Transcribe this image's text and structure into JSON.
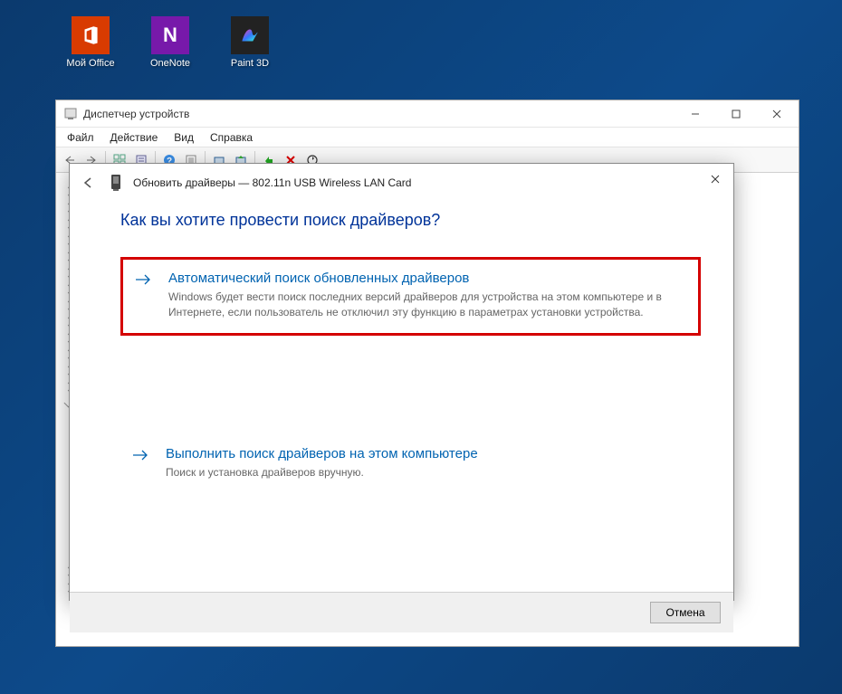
{
  "desktop": {
    "icons": [
      {
        "name": "office",
        "label": "Мой Office"
      },
      {
        "name": "onenote",
        "label": "OneNote",
        "glyph": "N"
      },
      {
        "name": "paint3d",
        "label": "Paint 3D"
      }
    ]
  },
  "devmgr": {
    "title": "Диспетчер устройств",
    "menu": {
      "file": "Файл",
      "action": "Действие",
      "view": "Вид",
      "help": "Справка"
    }
  },
  "dialog": {
    "header_prefix": "Обновить драйверы —",
    "device_name": "802.11n USB Wireless LAN Card",
    "question": "Как вы хотите провести поиск драйверов?",
    "option_auto": {
      "title": "Автоматический поиск обновленных драйверов",
      "desc": "Windows будет вести поиск последних версий драйверов для устройства на этом компьютере и в Интернете, если пользователь не отключил эту функцию в параметрах установки устройства."
    },
    "option_manual": {
      "title": "Выполнить поиск драйверов на этом компьютере",
      "desc": "Поиск и установка драйверов вручную."
    },
    "cancel": "Отмена"
  }
}
